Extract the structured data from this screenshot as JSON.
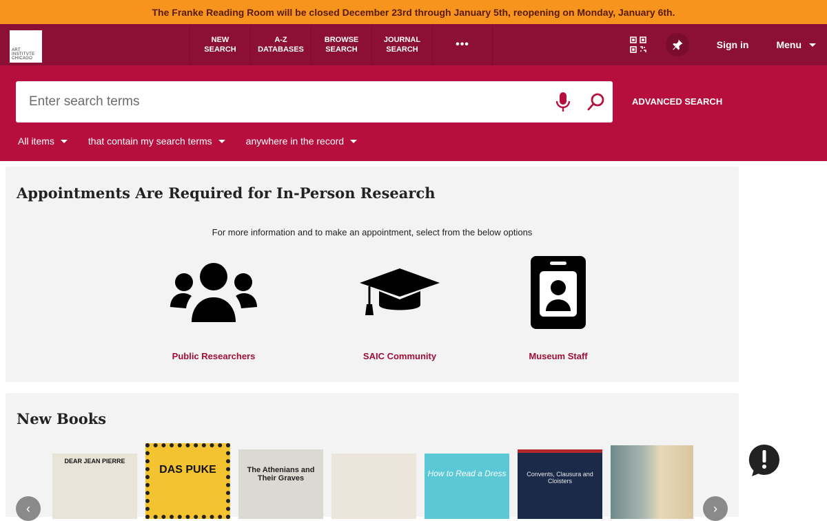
{
  "banner": {
    "text": "The Franke Reading Room will be closed December 23rd through January 5th, reopening on Monday, January 6th."
  },
  "logo": {
    "lines": [
      "ART",
      "INSTITVTE",
      "CHICAGO"
    ]
  },
  "nav": {
    "new_search": "NEW\nSEARCH",
    "az_databases": "A-Z\nDATABASES",
    "browse_search": "BROWSE\nSEARCH",
    "journal_search": "JOURNAL\nSEARCH",
    "more": "•••",
    "sign_in": "Sign in",
    "menu": "Menu"
  },
  "search": {
    "placeholder": "Enter search terms",
    "advanced": "ADVANCED SEARCH",
    "filter_scope": "All items",
    "filter_match": "that contain my search terms",
    "filter_field": "anywhere in the record"
  },
  "appointments": {
    "title": "Appointments Are Required for In-Person Research",
    "info": "For more information and to make an appointment, select from the below options",
    "options": [
      {
        "label": "Public Researchers",
        "icon": "users-icon"
      },
      {
        "label": "SAIC Community",
        "icon": "graduation-cap-icon"
      },
      {
        "label": "Museum Staff",
        "icon": "id-badge-icon"
      }
    ]
  },
  "new_books": {
    "title": "New Books",
    "books": [
      {
        "cover_text": "DEAR JEAN PIERRE",
        "bg": "#e9e4d8"
      },
      {
        "cover_text": "DAS PUKE",
        "bg": "#f4c430"
      },
      {
        "cover_text": "The Athenians and Their Graves",
        "bg": "#dcd8d2"
      },
      {
        "cover_text": "",
        "bg": "#ece5dc"
      },
      {
        "cover_text": "How to Read a Dress",
        "bg": "#5bc8d6"
      },
      {
        "cover_text": "Convents, Clausura and Cloisters",
        "bg": "#1c2a4a"
      },
      {
        "cover_text": "",
        "bg": "#8aa0a0"
      }
    ]
  },
  "colors": {
    "banner": "#f7941d",
    "nav": "#8c0f35",
    "search_zone": "#b60f3d",
    "accent": "#9e0e39"
  }
}
